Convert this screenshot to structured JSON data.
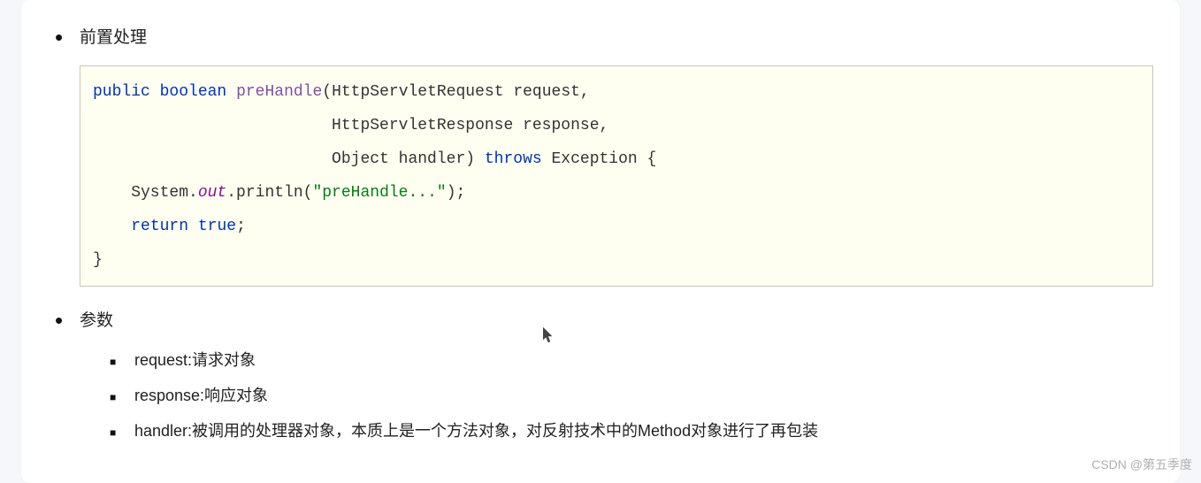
{
  "sections": {
    "prehandle": {
      "title": "前置处理",
      "code": {
        "p1": "public",
        "p2": " ",
        "p3": "boolean",
        "p4": " ",
        "p5": "preHandle",
        "p6": "(HttpServletRequest request,",
        "p7": "                         HttpServletResponse response,",
        "p8": "                         Object handler) ",
        "p9": "throws",
        "p10": " Exception {",
        "p11": "    System.",
        "p12": "out",
        "p13": ".println(",
        "p14": "\"preHandle...\"",
        "p15": ");",
        "p16": "    ",
        "p17": "return",
        "p18": " ",
        "p19": "true",
        "p20": ";",
        "p21": "}"
      }
    },
    "params": {
      "title": "参数",
      "items": {
        "0": "request:请求对象",
        "1": "response:响应对象",
        "2": "handler:被调用的处理器对象，本质上是一个方法对象，对反射技术中的Method对象进行了再包装"
      }
    }
  },
  "watermark": "CSDN @第五季度"
}
